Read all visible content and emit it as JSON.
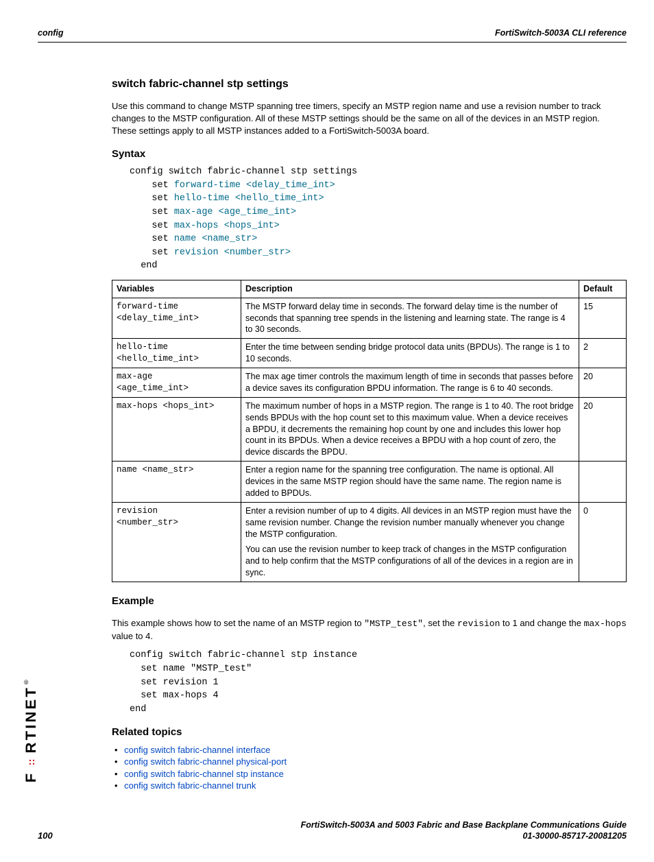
{
  "header": {
    "left": "config",
    "right": "FortiSwitch-5003A CLI reference"
  },
  "title": "switch fabric-channel stp settings",
  "intro": "Use this command to change MSTP spanning tree timers, specify an MSTP region name and use a revision number to track changes to the MSTP configuration. All of these MSTP settings should be the same on all of the devices in an MSTP region. These settings apply to all MSTP instances added to a FortiSwitch-5003A board.",
  "syntax_heading": "Syntax",
  "syntax": {
    "l1": "config switch fabric-channel stp settings",
    "l2a": "set ",
    "l2b": "forward-time <delay_time_int>",
    "l3a": "set ",
    "l3b": "hello-time <hello_time_int>",
    "l4a": "set ",
    "l4b": "max-age <age_time_int>",
    "l5a": "set ",
    "l5b": "max-hops <hops_int>",
    "l6a": "set ",
    "l6b": "name <name_str>",
    "l7a": "set ",
    "l7b": "revision <number_str>",
    "l8": "end"
  },
  "table": {
    "h1": "Variables",
    "h2": "Description",
    "h3": "Default",
    "rows": [
      {
        "v1": "forward-time",
        "v2": "<delay_time_int>",
        "d": "The MSTP forward delay time in seconds. The forward delay time is the number of seconds that spanning tree spends in the listening and learning state. The range is 4 to 30 seconds.",
        "def": "15"
      },
      {
        "v1": "hello-time",
        "v2": "<hello_time_int>",
        "d": "Enter the time between sending bridge protocol data units (BPDUs). The range is 1 to 10 seconds.",
        "def": "2"
      },
      {
        "v1": "max-age",
        "v2": "<age_time_int>",
        "d": "The max age timer controls the maximum length of time in seconds that passes before a device saves its configuration BPDU information. The range is 6 to 40 seconds.",
        "def": "20"
      },
      {
        "v1": "max-hops <hops_int>",
        "v2": "",
        "d": "The maximum number of hops in a MSTP region. The range is 1 to 40. The root bridge sends BPDUs with the hop count set to this maximum value. When a device receives a BPDU, it decrements the remaining hop count by one and includes this lower hop count in its BPDUs. When a device receives a BPDU with a hop count of zero, the device discards the BPDU.",
        "def": "20"
      },
      {
        "v1": "name <name_str>",
        "v2": "",
        "d": "Enter a region name for the spanning tree configuration. The name is optional. All devices in the same MSTP region should have the same name. The region name is added to BPDUs.",
        "def": ""
      },
      {
        "v1": "revision",
        "v2": "<number_str>",
        "d1": "Enter a revision number of up to 4 digits. All devices in an MSTP region must have the same revision number. Change the revision number manually whenever you change the MSTP configuration.",
        "d2": "You can use the revision number to keep track of changes in the MSTP configuration and to help confirm that the MSTP configurations of all of the devices in a region are in sync.",
        "def": "0"
      }
    ]
  },
  "example_heading": "Example",
  "example_text_1": "This example shows how to set the name of an MSTP region to ",
  "example_text_code1": "\"MSTP_test\"",
  "example_text_2": ", set the ",
  "example_text_code2": "revision",
  "example_text_3": " to 1 and change the ",
  "example_text_code3": "max-hops",
  "example_text_4": " value to 4.",
  "example_code": "config switch fabric-channel stp instance\n  set name \"MSTP_test\"\n  set revision 1\n  set max-hops 4\nend",
  "related_heading": "Related topics",
  "related": [
    "config switch fabric-channel interface",
    "config switch fabric-channel physical-port",
    "config switch fabric-channel stp instance",
    "config switch fabric-channel trunk"
  ],
  "footer": {
    "page": "100",
    "line1": "FortiSwitch-5003A and 5003   Fabric and Base Backplane Communications Guide",
    "line2": "01-30000-85717-20081205"
  },
  "logo_text": "FORTINET"
}
